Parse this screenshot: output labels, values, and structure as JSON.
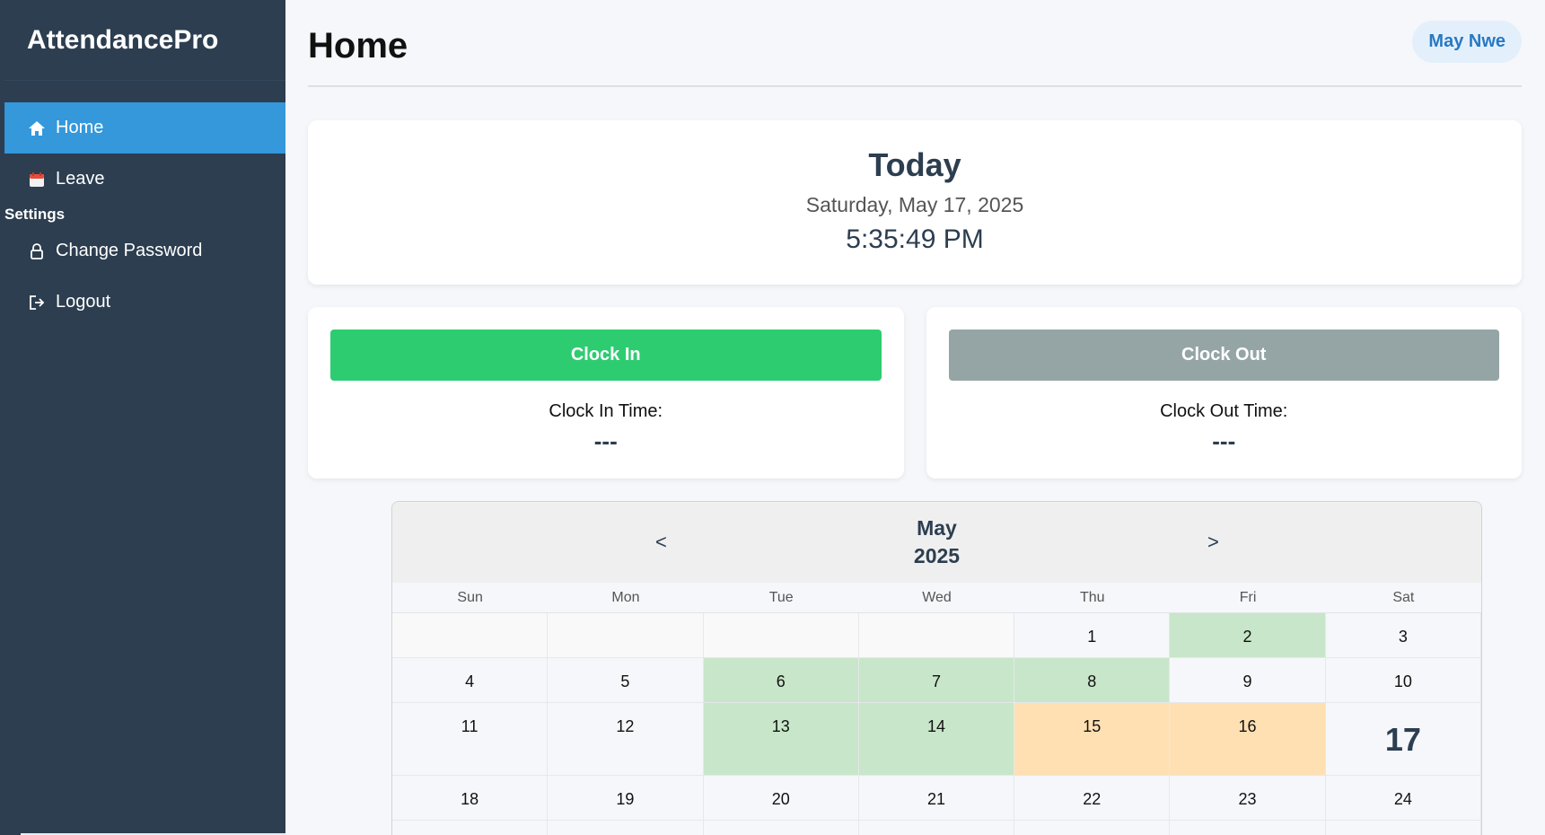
{
  "app": {
    "brand": "AttendancePro"
  },
  "sidebar": {
    "items": [
      {
        "label": "Home",
        "icon": "home-icon",
        "active": true
      },
      {
        "label": "Leave",
        "icon": "calendar-icon",
        "active": false
      }
    ],
    "section_label": "Settings",
    "settings_items": [
      {
        "label": "Change Password",
        "icon": "lock-icon"
      },
      {
        "label": "Logout",
        "icon": "logout-icon"
      }
    ]
  },
  "header": {
    "title": "Home",
    "user": "May Nwe"
  },
  "today": {
    "title": "Today",
    "date": "Saturday, May 17, 2025",
    "time": "5:35:49 PM"
  },
  "clock_in": {
    "button": "Clock In",
    "label": "Clock In Time:",
    "value": "---"
  },
  "clock_out": {
    "button": "Clock Out",
    "label": "Clock Out Time:",
    "value": "---"
  },
  "calendar": {
    "month": "May",
    "year": "2025",
    "prev": "<",
    "next": ">",
    "weekdays": [
      "Sun",
      "Mon",
      "Tue",
      "Wed",
      "Thu",
      "Fri",
      "Sat"
    ],
    "weeks": [
      [
        {
          "day": "",
          "status": "empty"
        },
        {
          "day": "",
          "status": "empty"
        },
        {
          "day": "",
          "status": "empty"
        },
        {
          "day": "",
          "status": "empty"
        },
        {
          "day": "1",
          "status": "none"
        },
        {
          "day": "2",
          "status": "present"
        },
        {
          "day": "3",
          "status": "none"
        }
      ],
      [
        {
          "day": "4",
          "status": "none"
        },
        {
          "day": "5",
          "status": "none"
        },
        {
          "day": "6",
          "status": "present"
        },
        {
          "day": "7",
          "status": "present"
        },
        {
          "day": "8",
          "status": "present"
        },
        {
          "day": "9",
          "status": "none"
        },
        {
          "day": "10",
          "status": "none"
        }
      ],
      [
        {
          "day": "11",
          "status": "none"
        },
        {
          "day": "12",
          "status": "none"
        },
        {
          "day": "13",
          "status": "present"
        },
        {
          "day": "14",
          "status": "present"
        },
        {
          "day": "15",
          "status": "leave"
        },
        {
          "day": "16",
          "status": "leave"
        },
        {
          "day": "17",
          "status": "today"
        }
      ],
      [
        {
          "day": "18",
          "status": "none"
        },
        {
          "day": "19",
          "status": "none"
        },
        {
          "day": "20",
          "status": "none"
        },
        {
          "day": "21",
          "status": "none"
        },
        {
          "day": "22",
          "status": "none"
        },
        {
          "day": "23",
          "status": "none"
        },
        {
          "day": "24",
          "status": "none"
        }
      ],
      [
        {
          "day": "",
          "status": "none"
        },
        {
          "day": "",
          "status": "none"
        },
        {
          "day": "",
          "status": "none"
        },
        {
          "day": "",
          "status": "none"
        },
        {
          "day": "",
          "status": "none"
        },
        {
          "day": "",
          "status": "none"
        },
        {
          "day": "",
          "status": "none"
        }
      ]
    ]
  },
  "colors": {
    "sidebar_bg": "#2c3e50",
    "active_nav": "#3498db",
    "clock_in": "#2ecc71",
    "clock_out": "#95a5a6",
    "present_day": "#c8e6c9",
    "leave_day": "#ffe0b2"
  }
}
